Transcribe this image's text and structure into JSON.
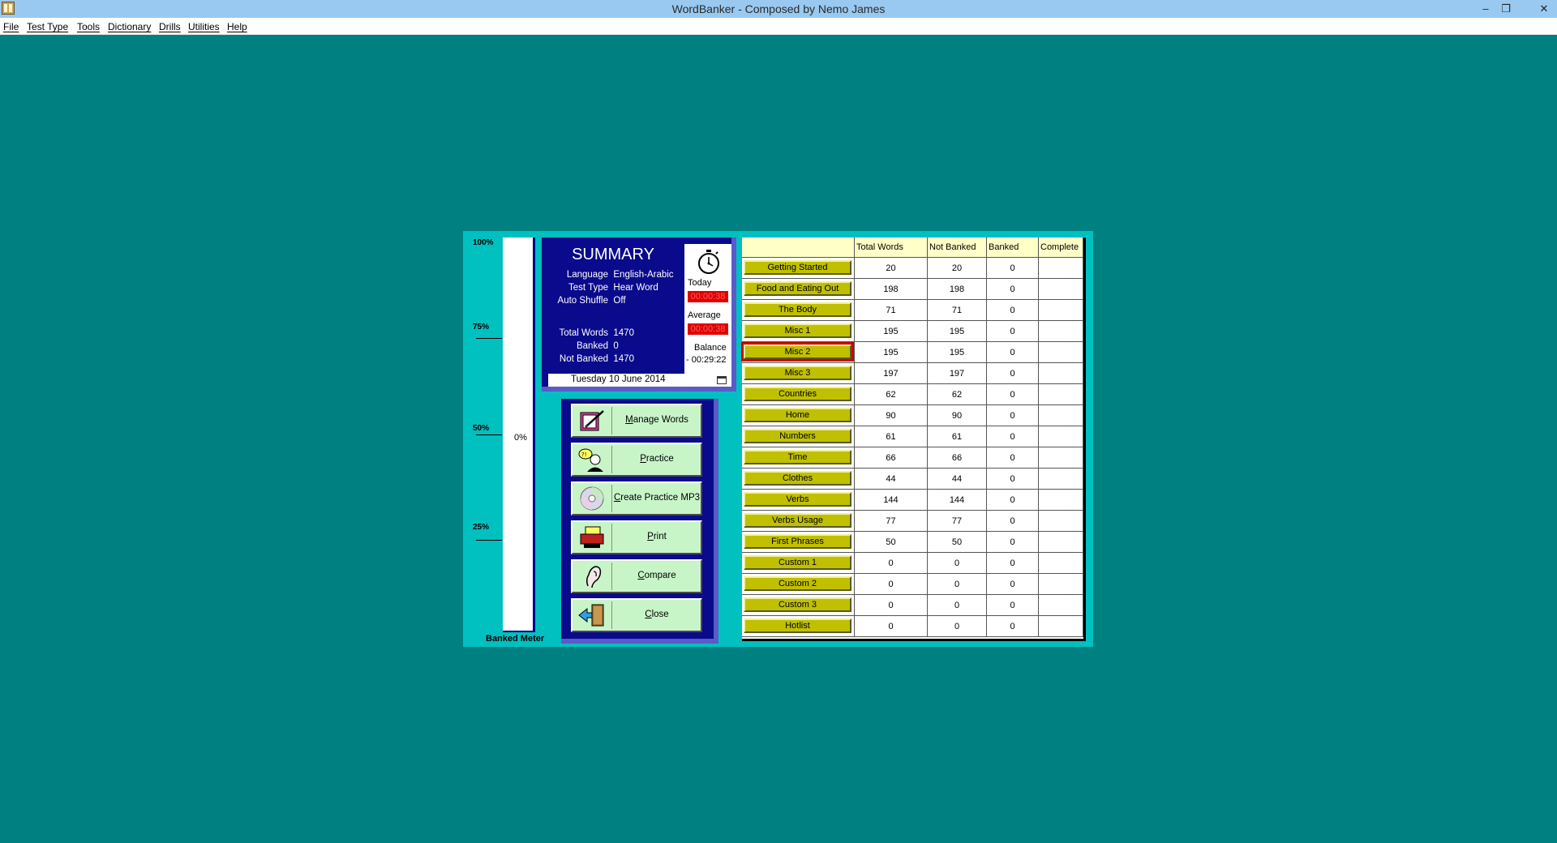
{
  "window": {
    "title": "WordBanker - Composed by Nemo James",
    "minimize": "–",
    "restore": "❐",
    "close": "✕"
  },
  "menu": [
    "File",
    "Test Type",
    "Tools",
    "Dictionary",
    "Drills",
    "Utilities",
    "Help"
  ],
  "meter": {
    "labels": [
      "100%",
      "75%",
      "50%",
      "25%"
    ],
    "value_text": "0%",
    "banked_fraction": 0,
    "title": "Banked Meter"
  },
  "summary": {
    "title": "SUMMARY",
    "language_label": "Language",
    "language_value": "English-Arabic",
    "test_type_label": "Test Type",
    "test_type_value": "Hear Word",
    "auto_shuffle_label": "Auto Shuffle",
    "auto_shuffle_value": "Off",
    "total_words_label": "Total Words",
    "total_words_value": "1470",
    "banked_label": "Banked",
    "banked_value": "0",
    "not_banked_label": "Not Banked",
    "not_banked_value": "1470",
    "today_label": "Today",
    "today_value": "00:00:38",
    "average_label": "Average",
    "average_value": "00:00:38",
    "balance_label": "Balance",
    "balance_value": "- 00:29:22",
    "date": "Tuesday 10 June 2014",
    "stopwatch_icon": "stopwatch-icon",
    "calendar_icon": "calendar-icon"
  },
  "actions": [
    {
      "label": "Manage Words",
      "icon": "manage-words-icon"
    },
    {
      "label": "Practice",
      "icon": "practice-icon"
    },
    {
      "label": "Create Practice MP3",
      "icon": "cd-icon"
    },
    {
      "label": "Print",
      "icon": "printer-icon"
    },
    {
      "label": "Compare",
      "icon": "ear-icon"
    },
    {
      "label": "Close",
      "icon": "exit-door-icon"
    }
  ],
  "table": {
    "headers": [
      "",
      "Total Words",
      "Not Banked",
      "Banked",
      "Complete"
    ],
    "selected_row": "Misc 2",
    "rows": [
      {
        "name": "Getting Started",
        "total": "20",
        "not_banked": "20",
        "banked": "0",
        "complete": ""
      },
      {
        "name": "Food and Eating Out",
        "total": "198",
        "not_banked": "198",
        "banked": "0",
        "complete": ""
      },
      {
        "name": "The Body",
        "total": "71",
        "not_banked": "71",
        "banked": "0",
        "complete": ""
      },
      {
        "name": "Misc 1",
        "total": "195",
        "not_banked": "195",
        "banked": "0",
        "complete": ""
      },
      {
        "name": "Misc 2",
        "total": "195",
        "not_banked": "195",
        "banked": "0",
        "complete": ""
      },
      {
        "name": "Misc 3",
        "total": "197",
        "not_banked": "197",
        "banked": "0",
        "complete": ""
      },
      {
        "name": "Countries",
        "total": "62",
        "not_banked": "62",
        "banked": "0",
        "complete": ""
      },
      {
        "name": "Home",
        "total": "90",
        "not_banked": "90",
        "banked": "0",
        "complete": ""
      },
      {
        "name": "Numbers",
        "total": "61",
        "not_banked": "61",
        "banked": "0",
        "complete": ""
      },
      {
        "name": "Time",
        "total": "66",
        "not_banked": "66",
        "banked": "0",
        "complete": ""
      },
      {
        "name": "Clothes",
        "total": "44",
        "not_banked": "44",
        "banked": "0",
        "complete": ""
      },
      {
        "name": "Verbs",
        "total": "144",
        "not_banked": "144",
        "banked": "0",
        "complete": ""
      },
      {
        "name": "Verbs Usage",
        "total": "77",
        "not_banked": "77",
        "banked": "0",
        "complete": ""
      },
      {
        "name": "First Phrases",
        "total": "50",
        "not_banked": "50",
        "banked": "0",
        "complete": ""
      },
      {
        "name": "Custom 1",
        "total": "0",
        "not_banked": "0",
        "banked": "0",
        "complete": ""
      },
      {
        "name": "Custom 2",
        "total": "0",
        "not_banked": "0",
        "banked": "0",
        "complete": ""
      },
      {
        "name": "Custom 3",
        "total": "0",
        "not_banked": "0",
        "banked": "0",
        "complete": ""
      },
      {
        "name": "Hotlist",
        "total": "0",
        "not_banked": "0",
        "banked": "0",
        "complete": ""
      }
    ]
  },
  "colors": {
    "desktop": "#008080",
    "panel": "#00c0c0",
    "summary_bg": "#0a0a8c",
    "action_button": "#c8f5c8",
    "category_button": "#c0c000",
    "timer_red": "#e00000",
    "selection": "#d00000"
  }
}
